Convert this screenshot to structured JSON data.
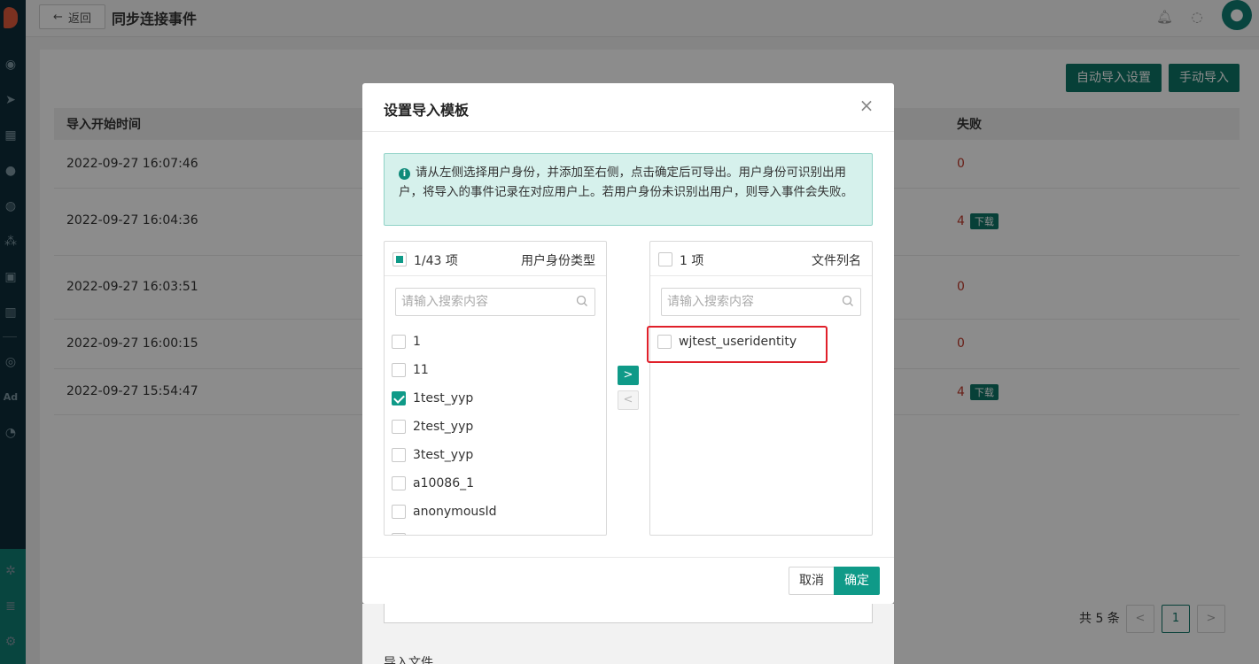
{
  "header": {
    "back_label": "返回",
    "title": "同步连接事件"
  },
  "toolbar": {
    "auto_import": "自动导入设置",
    "manual_import": "手动导入"
  },
  "table": {
    "columns": [
      "导入开始时间",
      "失败"
    ],
    "download_label": "下载",
    "rows": [
      {
        "time": "2022-09-27 16:07:46",
        "fail": "0",
        "download": false
      },
      {
        "time": "2022-09-27 16:04:36",
        "fail": "4",
        "download": true
      },
      {
        "time": "2022-09-27 16:03:51",
        "fail": "0",
        "download": false
      },
      {
        "time": "2022-09-27 16:00:15",
        "fail": "0",
        "download": false
      },
      {
        "time": "2022-09-27 15:54:47",
        "fail": "4",
        "download": true
      }
    ]
  },
  "pagination": {
    "total": "共 5 条",
    "prev": "<",
    "current": "1",
    "next": ">"
  },
  "below_modal": {
    "label": "导入文件"
  },
  "modal": {
    "title": "设置导入模板",
    "close": "×",
    "alert_icon": "i",
    "alert_text": "请从左侧选择用户身份，并添加至右侧，点击确定后可导出。用户身份可识别出用户，将导入的事件记录在对应用户上。若用户身份未识别出用户，则导入事件会失败。",
    "left_panel": {
      "count": "1/43 项",
      "title": "用户身份类型",
      "search_placeholder": "请输入搜索内容",
      "items": [
        {
          "label": "1",
          "checked": false
        },
        {
          "label": "11",
          "checked": false
        },
        {
          "label": "1test_yyp",
          "checked": true
        },
        {
          "label": "2test_yyp",
          "checked": false
        },
        {
          "label": "3test_yyp",
          "checked": false
        },
        {
          "label": "a10086_1",
          "checked": false
        },
        {
          "label": "anonymousId",
          "checked": false
        }
      ]
    },
    "transfer": {
      "to_right": ">",
      "to_left": "<"
    },
    "right_panel": {
      "count": "1 项",
      "title": "文件列名",
      "search_placeholder": "请输入搜索内容",
      "items": [
        {
          "label": "wjtest_useridentity",
          "checked": false
        }
      ]
    },
    "cancel": "取消",
    "ok": "确定"
  },
  "colors": {
    "primary": "#0f9a88",
    "dark_primary": "#0d7566",
    "danger": "#c0392b",
    "nav_bg": "#0d2d3a",
    "highlight": "#e0202a"
  }
}
